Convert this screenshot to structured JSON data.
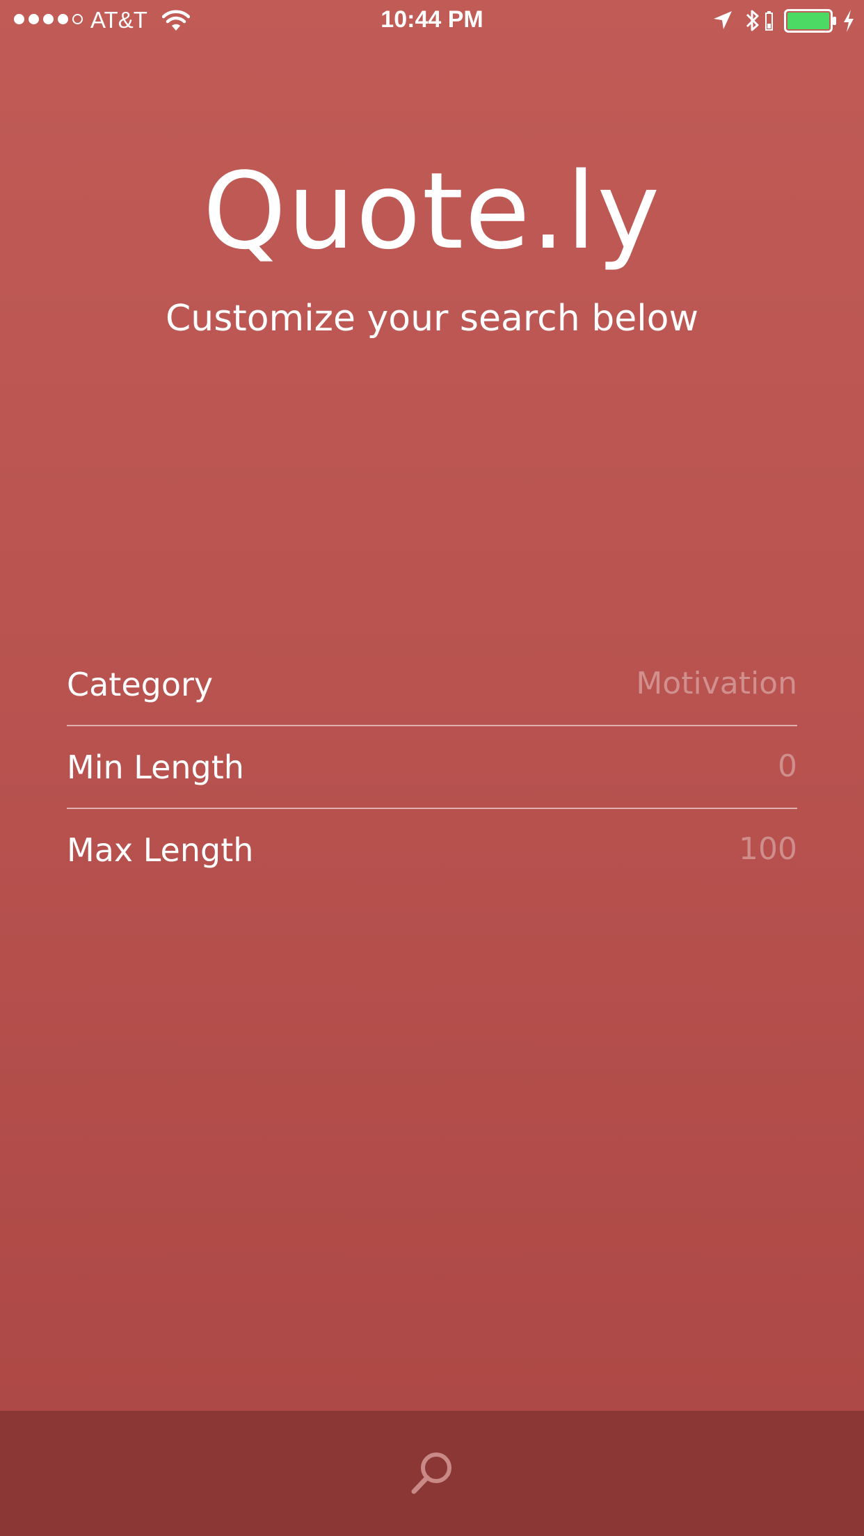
{
  "status_bar": {
    "carrier": "AT&T",
    "time": "10:44 PM",
    "signal_bars_filled": 4,
    "signal_bars_total": 5,
    "battery_color": "#4cd964"
  },
  "header": {
    "title": "Quote.ly",
    "subtitle": "Customize your search below"
  },
  "settings": {
    "rows": [
      {
        "label": "Category",
        "value": "Motivation"
      },
      {
        "label": "Min Length",
        "value": "0"
      },
      {
        "label": "Max Length",
        "value": "100"
      }
    ]
  },
  "bottom_bar": {
    "icon": "search-icon",
    "background": "#8a3735"
  },
  "colors": {
    "background_top": "#c05b56",
    "background_bottom": "#ab4744",
    "text": "#ffffff"
  }
}
